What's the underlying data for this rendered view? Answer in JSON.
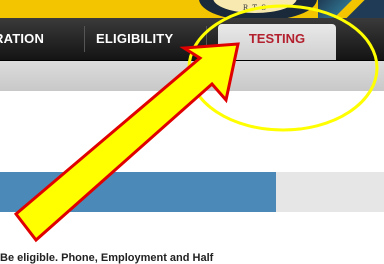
{
  "nav": {
    "items": [
      {
        "label": "RATION"
      },
      {
        "label": "ELIGIBILITY"
      },
      {
        "label": "TESTING"
      }
    ]
  },
  "logo": {
    "text": "R T S"
  },
  "progress": {
    "value": 0.72
  },
  "content": {
    "bottom_text": "Be eligible. Phone, Employment and Half"
  },
  "colors": {
    "nav_bg": "#1e1e1e",
    "active_tab_text": "#b3202e",
    "header_yellow": "#f3c400",
    "progress_fill": "#4b8ab8",
    "arrow_fill": "#ffff00",
    "arrow_outline": "#e00000",
    "highlight_circle": "#ffff00"
  },
  "icons": {
    "annotation_arrow": "arrow-icon",
    "highlight": "circle-highlight"
  }
}
